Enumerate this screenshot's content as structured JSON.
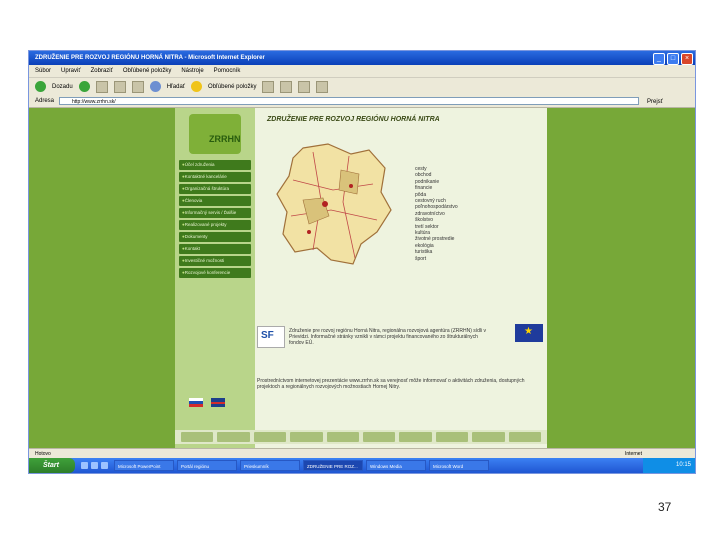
{
  "window": {
    "title": "ZDRUŽENIE PRE ROZVOJ REGIÓNU HORNÁ NITRA - Microsoft Internet Explorer"
  },
  "menu": [
    "Súbor",
    "Upraviť",
    "Zobraziť",
    "Obľúbené položky",
    "Nástroje",
    "Pomocník"
  ],
  "toolbar": {
    "back_label": "Dozadu",
    "search_label": "Hľadať",
    "favorites_label": "Obľúbené položky"
  },
  "address": {
    "label": "Adresa",
    "url": "http://www.zrrhn.sk/",
    "go_label": "Prejsť"
  },
  "site": {
    "logo_text": "ZRRHN",
    "heading": "ZDRUŽENIE PRE ROZVOJ REGIÓNU HORNÁ NITRA",
    "nav": [
      "Účel združenia",
      "Kontaktné kancelárie",
      "Organizačná štruktúra",
      "Členovia",
      "Informačný servis / Ďalšie",
      "Realizované projekty",
      "Dokumenty",
      "Kontakt",
      "Investičné možnosti",
      "Rozvojové konferencie"
    ],
    "categories": [
      "cesty",
      "obchod",
      "podnikanie",
      "financie",
      "pôda",
      "cestovný ruch",
      "poľnohospodárstvo",
      "zdravotníctvo",
      "školstvo",
      "tretí sektor",
      "kultúra",
      "životné prostredie",
      "ekológia",
      "turistika",
      "šport"
    ],
    "sf_logo": "SF",
    "info_text": "Združenie pre rozvoj regiónu Horná Nitra, regionálna rozvojová agentúra (ZRRHN) sídli v Prievidzi. Informačné stránky vznikli v rámci projektu financovaného zo štrukturálnych fondov EÚ.",
    "info_text2": "Prostredníctvom internetovej prezentácie www.zrrhn.sk sa verejnosť môže informovať o aktivitách združenia, dostupných projektoch a regionálnych rozvojových možnostiach Hornej Nitry."
  },
  "status": {
    "left": "Hotovo",
    "right": "Internet"
  },
  "taskbar": {
    "start_label": "Štart",
    "tasks": [
      "Microsoft PowerPoint",
      "Portál regiónu",
      "Prieskumník",
      "ZDRUŽENIE PRE ROZ...",
      "Windows Media",
      "Microsoft Word"
    ],
    "clock": "10:15"
  },
  "page_number": "37"
}
